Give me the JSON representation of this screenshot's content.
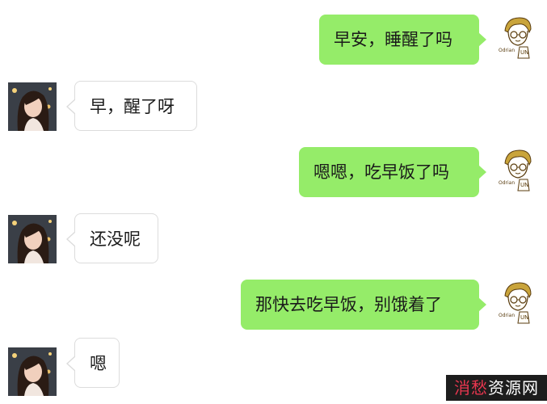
{
  "messages": [
    {
      "sender": "me",
      "text": "早安，睡醒了吗"
    },
    {
      "sender": "her",
      "text": "早，醒了呀"
    },
    {
      "sender": "me",
      "text": "嗯嗯，吃早饭了吗"
    },
    {
      "sender": "her",
      "text": "还没呢"
    },
    {
      "sender": "me",
      "text": "那快去吃早饭，别饿着了"
    },
    {
      "sender": "her",
      "text": "嗯"
    }
  ],
  "avatars": {
    "me": {
      "caption": "Odrian",
      "icon": "cartoon-boy-avatar-icon"
    },
    "her": {
      "icon": "girl-photo-avatar-icon"
    }
  },
  "watermark": {
    "accent": "消愁",
    "rest": "资源网"
  },
  "colors": {
    "my_bubble": "#95ec69",
    "her_bubble": "#ffffff",
    "border": "#dcdcdc"
  }
}
